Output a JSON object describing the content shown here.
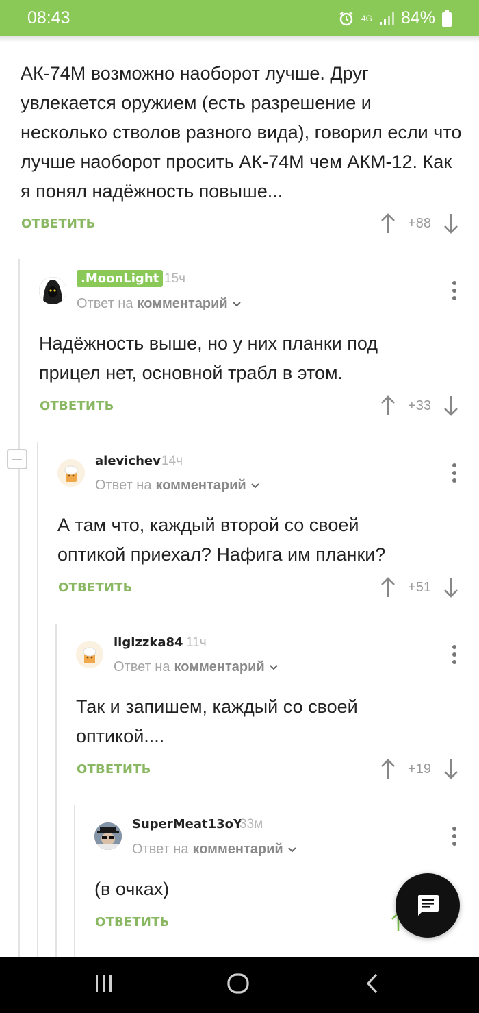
{
  "status_bar": {
    "time": "08:43",
    "network": "4G",
    "battery": "84%"
  },
  "comments": [
    {
      "text": "АК-74М возможно наоборот лучше. Друг увлекается оружием (есть разрешение и несколько стволов разного вида), говорил если что лучше наоборот просить АК-74М чем АКМ-12. Как я понял надёжность повыше...",
      "reply_label": "ОТВЕТИТЬ",
      "rating": "+88"
    },
    {
      "user": ".MoonLight",
      "ago": "15ч",
      "meta_prefix": "Ответ на",
      "meta_link": "комментарий",
      "text": "Надёжность выше, но у них планки под прицел нет, основной трабл в этом.",
      "reply_label": "ОТВЕТИТЬ",
      "rating": "+33"
    },
    {
      "user": "alevichev",
      "ago": "14ч",
      "meta_prefix": "Ответ на",
      "meta_link": "комментарий",
      "text": "А там что, каждый второй со своей оптикой приехал? Нафига им планки?",
      "reply_label": "ОТВЕТИТЬ",
      "rating": "+51"
    },
    {
      "user": "ilgizzka84",
      "ago": "11ч",
      "meta_prefix": "Ответ на",
      "meta_link": "комментарий",
      "text": "Так и запишем, каждый со своей оптикой....",
      "reply_label": "ОТВЕТИТЬ",
      "rating": "+19"
    },
    {
      "user": "SuperMeat13oY",
      "ago": "33м",
      "meta_prefix": "Ответ на",
      "meta_link": "комментарий",
      "text": "(в очках)",
      "reply_label": "ОТВЕТИТЬ"
    }
  ],
  "icons": {
    "upvote": "arrow-up-icon",
    "downvote": "arrow-down-icon",
    "more": "more-vertical-icon",
    "fab": "comment-icon",
    "nav": [
      "recent-apps-icon",
      "home-icon",
      "back-icon"
    ]
  },
  "colors": {
    "accent": "#8ac858",
    "reply": "#8ab862"
  }
}
